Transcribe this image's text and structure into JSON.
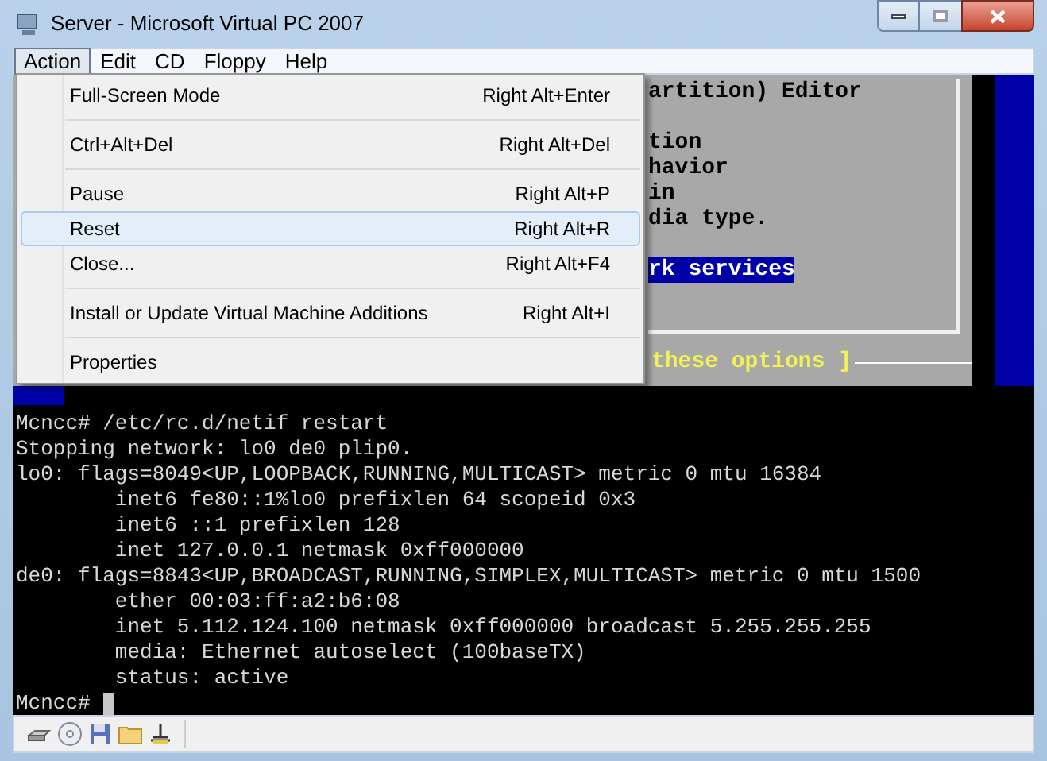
{
  "window": {
    "title": "Server - Microsoft Virtual PC 2007"
  },
  "menu_bar": [
    {
      "label": "Action",
      "selected": true
    },
    {
      "label": "Edit",
      "selected": false
    },
    {
      "label": "CD",
      "selected": false
    },
    {
      "label": "Floppy",
      "selected": false
    },
    {
      "label": "Help",
      "selected": false
    }
  ],
  "action_menu": {
    "groups": [
      [
        {
          "label": "Full-Screen Mode",
          "shortcut": "Right Alt+Enter",
          "selected": false
        }
      ],
      [
        {
          "label": "Ctrl+Alt+Del",
          "shortcut": "Right Alt+Del",
          "selected": false
        }
      ],
      [
        {
          "label": "Pause",
          "shortcut": "Right Alt+P",
          "selected": false
        },
        {
          "label": "Reset",
          "shortcut": "Right Alt+R",
          "selected": true
        },
        {
          "label": "Close...",
          "shortcut": "Right Alt+F4",
          "selected": false
        }
      ],
      [
        {
          "label": "Install or Update Virtual Machine Additions",
          "shortcut": "Right Alt+I",
          "selected": false
        }
      ],
      [
        {
          "label": "Properties",
          "selected": false
        }
      ]
    ]
  },
  "console": {
    "dialog_groups": [
      [
        {
          "text": "artition) Editor",
          "highlighted": false
        }
      ],
      [
        {
          "text": "tion",
          "highlighted": false
        },
        {
          "text": "havior",
          "highlighted": false
        },
        {
          "text": "in",
          "highlighted": false
        },
        {
          "text": "dia type.",
          "highlighted": false
        }
      ],
      [
        {
          "text": "rk services",
          "highlighted": true
        }
      ]
    ],
    "dialog_hint": "these options ]",
    "lines": [
      "Mcncc# /etc/rc.d/netif restart",
      "Stopping network: lo0 de0 plip0.",
      "lo0: flags=8049<UP,LOOPBACK,RUNNING,MULTICAST> metric 0 mtu 16384",
      "        inet6 fe80::1%lo0 prefixlen 64 scopeid 0x3",
      "        inet6 ::1 prefixlen 128",
      "        inet 127.0.0.1 netmask 0xff000000",
      "de0: flags=8843<UP,BROADCAST,RUNNING,SIMPLEX,MULTICAST> metric 0 mtu 1500",
      "        ether 00:03:ff:a2:b6:08",
      "        inet 5.112.124.100 netmask 0xff000000 broadcast 5.255.255.255",
      "        media: Ethernet autoselect (100baseTX)",
      "        status: active"
    ],
    "prompt": "Mcncc#"
  }
}
